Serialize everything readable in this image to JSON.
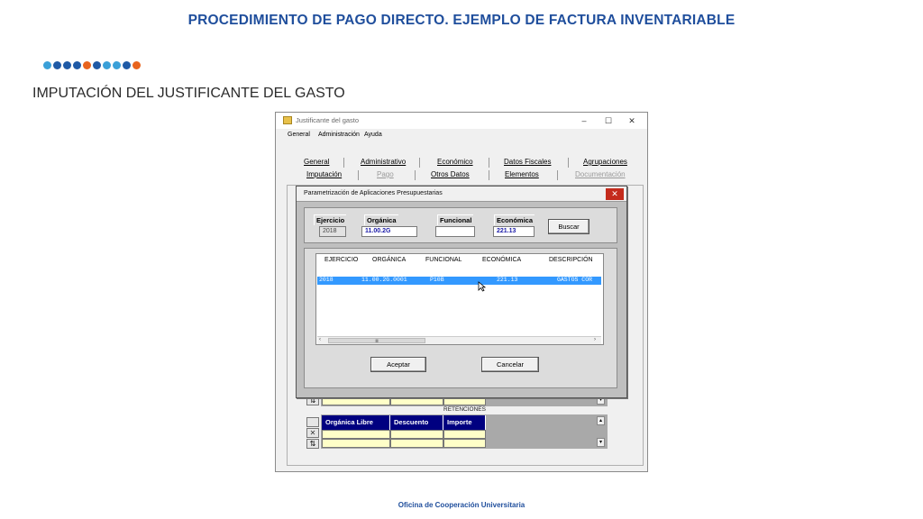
{
  "slide": {
    "title": "PROCEDIMIENTO DE PAGO DIRECTO. EJEMPLO DE FACTURA INVENTARIABLE",
    "subtitle": "IMPUTACIÓN DEL JUSTIFICANTE DEL GASTO",
    "footer": "Oficina de Cooperación Universitaria",
    "dot_colors": [
      "#3aa0d8",
      "#1f5aa6",
      "#1f5aa6",
      "#1f5aa6",
      "#e8641e",
      "#1f5aa6",
      "#3aa0d8",
      "#3aa0d8",
      "#1f5aa6",
      "#e8641e"
    ]
  },
  "window": {
    "title": "Justificante del gasto",
    "controls": {
      "minimize": "–",
      "maximize": "☐",
      "close": "✕"
    },
    "menu": [
      "General",
      "Administración",
      "Ayuda"
    ],
    "tabs_row1": [
      "General",
      "Administrativo",
      "Económico",
      "Datos Fiscales",
      "Agrupaciones"
    ],
    "tabs_row2": [
      "Imputación",
      "Pago",
      "Otros Datos",
      "Elementos",
      "Documentación"
    ]
  },
  "background_grid": {
    "section_label": "RETENCIONES",
    "retenciones_columns": [
      "Orgánica Libre",
      "Descuento",
      "Importe"
    ]
  },
  "dialog": {
    "title": "Parametrización de Aplicaciones Presupuestarias",
    "close_label": "✕",
    "fields": {
      "ejercicio": {
        "label": "Ejercicio",
        "value": "2018"
      },
      "organica": {
        "label": "Orgánica",
        "value": "11.00.2G"
      },
      "funcional": {
        "label": "Funcional",
        "value": ""
      },
      "economica": {
        "label": "Económica",
        "value": "221.13"
      }
    },
    "buscar_label": "Buscar",
    "results": {
      "columns": [
        "EJERCICIO",
        "ORGÁNICA",
        "FUNCIONAL",
        "ECONÓMICA",
        "DESCRIPCIÓN"
      ],
      "rows": [
        {
          "ejercicio": "2018",
          "organica": "11.00.2G.0001",
          "funcional": "P10B",
          "economica": "221.13",
          "descripcion": "GASTOS COR"
        }
      ]
    },
    "aceptar_label": "Aceptar",
    "cancelar_label": "Cancelar"
  }
}
